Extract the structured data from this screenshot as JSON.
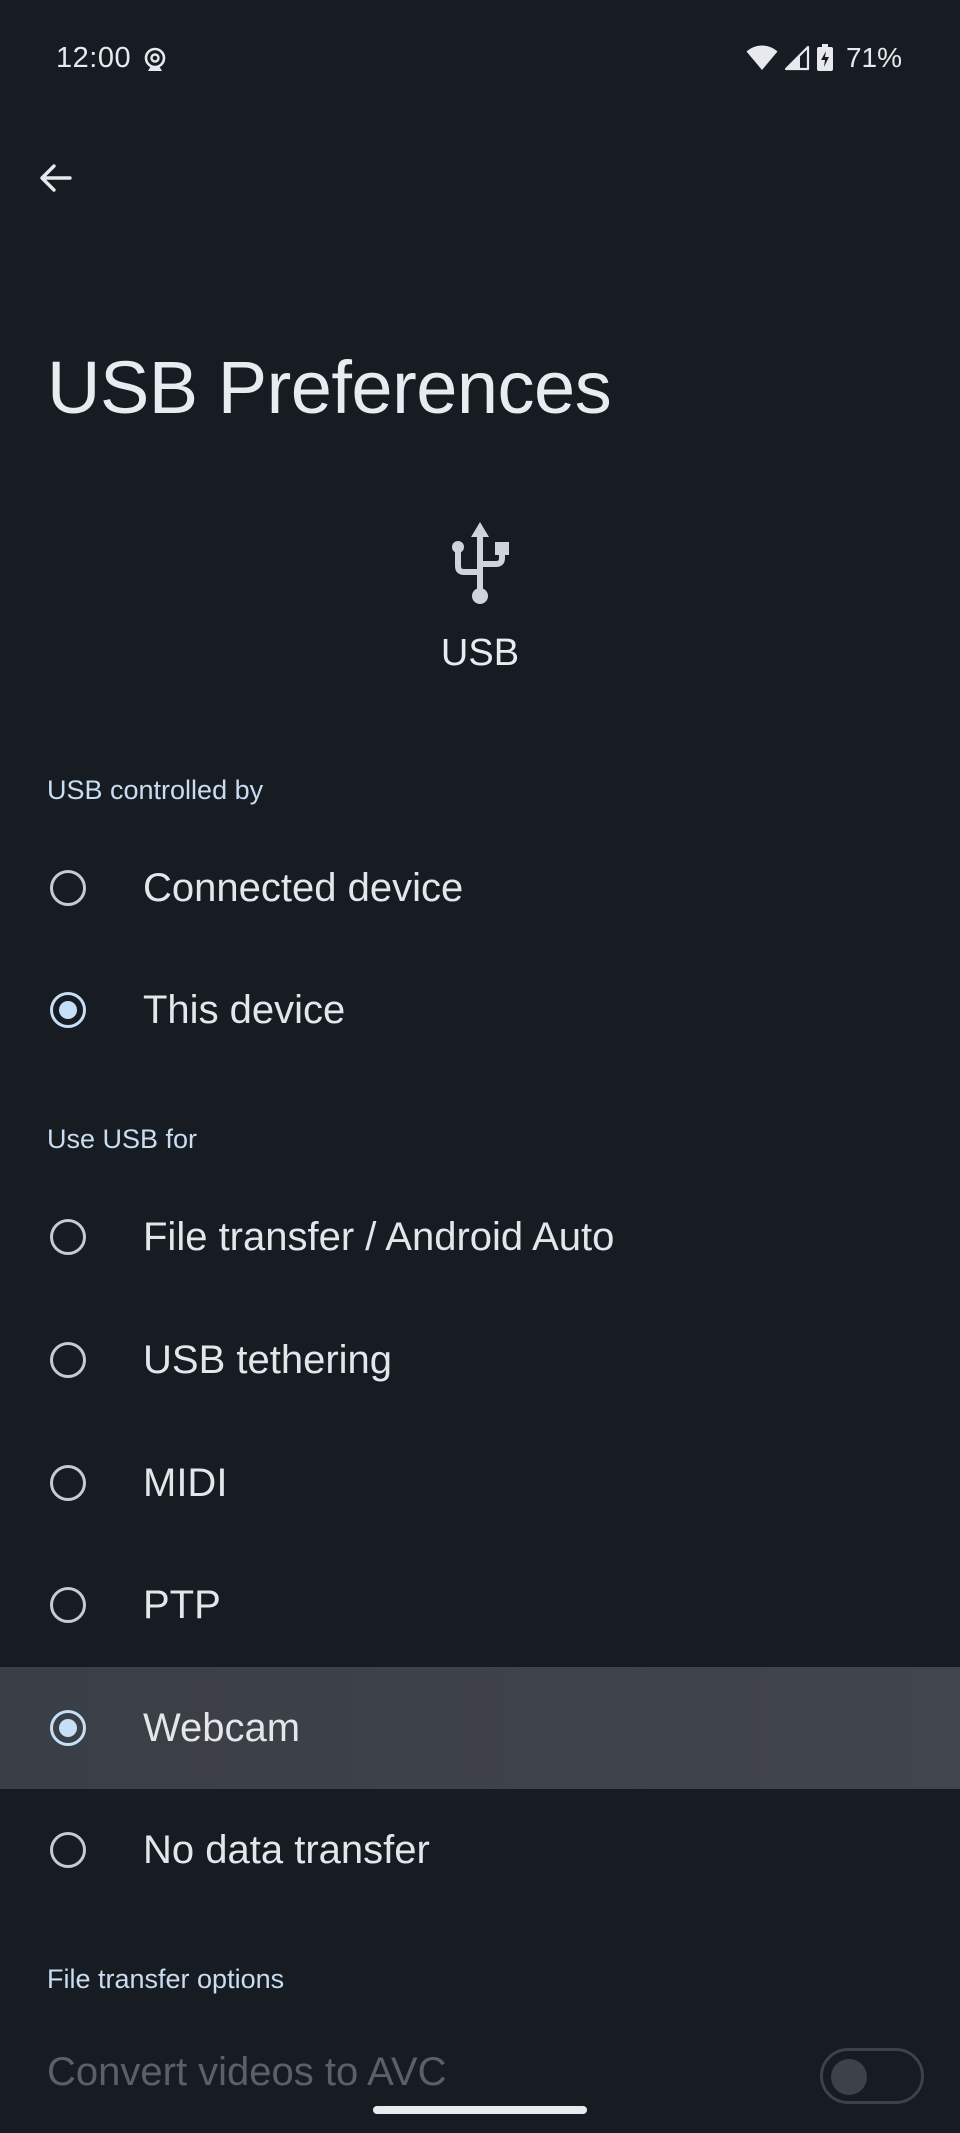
{
  "status_bar": {
    "time": "12:00",
    "battery_percent": "71%",
    "icons": [
      "webcam-icon",
      "wifi-icon",
      "signal-icon",
      "battery-charging-icon"
    ]
  },
  "nav": {
    "back_icon": "arrow-left-icon"
  },
  "title": "USB Preferences",
  "usb_header": {
    "icon": "usb-icon",
    "label": "USB"
  },
  "sections": {
    "controlled_by": {
      "header": "USB controlled by",
      "options": [
        {
          "label": "Connected device",
          "selected": false
        },
        {
          "label": "This device",
          "selected": true
        }
      ]
    },
    "use_usb_for": {
      "header": "Use USB for",
      "options": [
        {
          "label": "File transfer / Android Auto",
          "selected": false
        },
        {
          "label": "USB tethering",
          "selected": false
        },
        {
          "label": "MIDI",
          "selected": false
        },
        {
          "label": "PTP",
          "selected": false
        },
        {
          "label": "Webcam",
          "selected": true
        },
        {
          "label": "No data transfer",
          "selected": false
        }
      ]
    },
    "file_transfer_options": {
      "header": "File transfer options",
      "convert_videos": {
        "label": "Convert videos to AVC",
        "enabled": false,
        "on": false
      }
    }
  },
  "colors": {
    "background": "#171c23",
    "accent": "#c6dff7",
    "highlight_row": "#3d4148",
    "disabled_text": "#5b6068"
  }
}
